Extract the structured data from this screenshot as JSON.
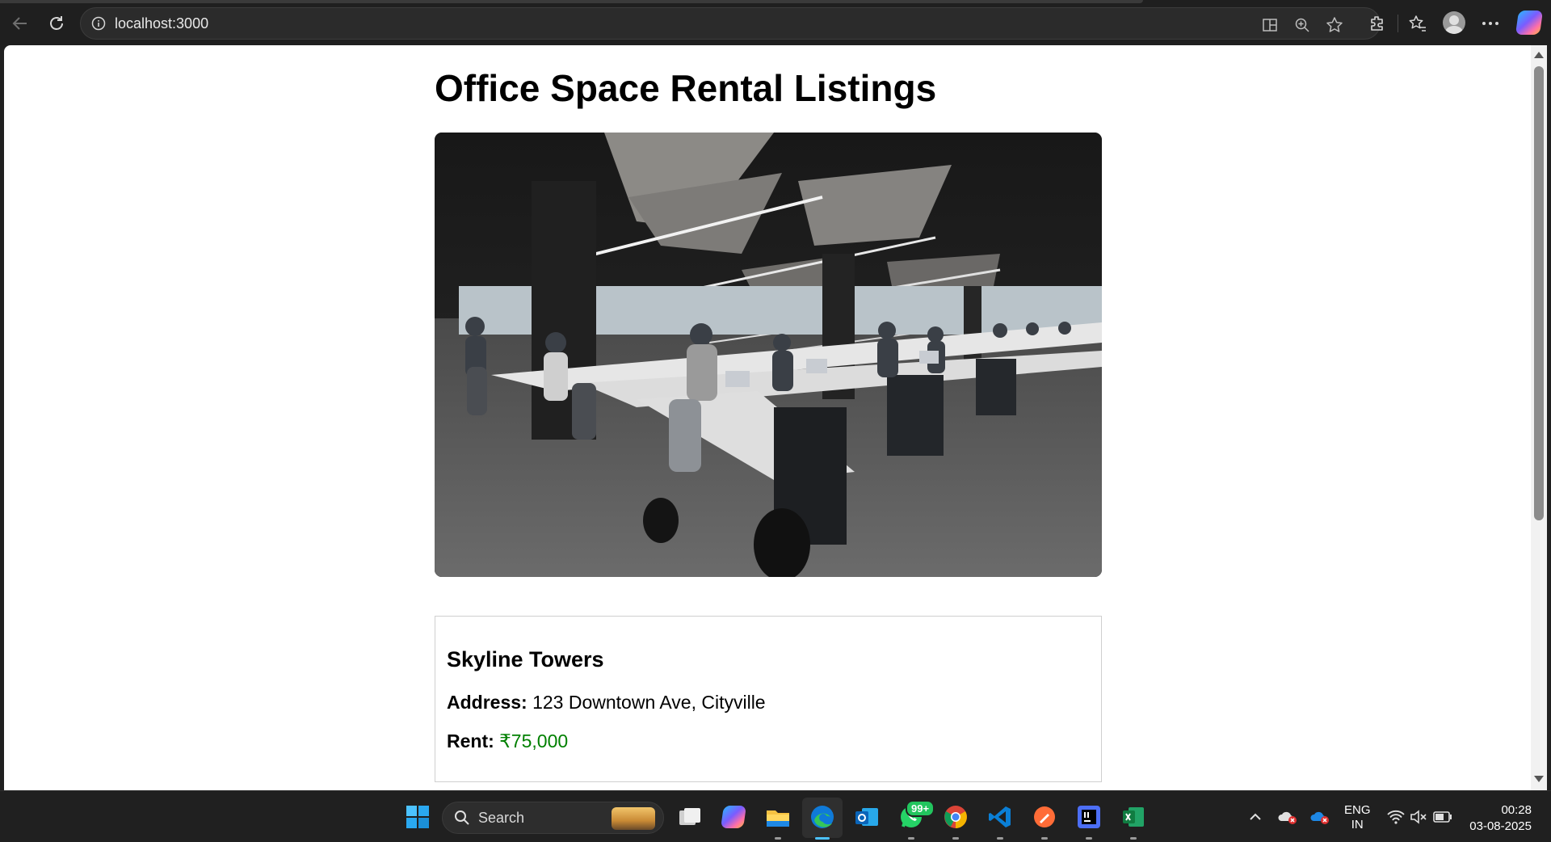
{
  "browser": {
    "url": "localhost:3000",
    "icons": [
      "back-arrow-icon",
      "refresh-icon",
      "site-info-icon",
      "split-screen-icon",
      "zoom-icon",
      "favorite-star-icon",
      "extensions-icon",
      "favorites-icon",
      "profile-avatar-icon",
      "more-options-icon",
      "copilot-icon"
    ]
  },
  "page": {
    "title": "Office Space Rental Listings",
    "hero_image": "open-plan-office-with-people-at-desks",
    "listing": {
      "name": "Skyline Towers",
      "address_label": "Address:",
      "address_value": "123 Downtown Ave, Cityville",
      "rent_label": "Rent:",
      "rent_value": "₹75,000",
      "rent_color": "#008000"
    }
  },
  "taskbar": {
    "search_label": "Search",
    "whatsapp_badge": "99+",
    "apps": [
      "windows-start-icon",
      "search-icon",
      "task-view-icon",
      "copilot-app-icon",
      "file-explorer-icon",
      "edge-browser-icon",
      "outlook-icon",
      "whatsapp-icon",
      "chrome-icon",
      "vscode-icon",
      "postman-icon",
      "intellij-icon",
      "excel-icon"
    ],
    "tray": {
      "language_line1": "ENG",
      "language_line2": "IN",
      "time": "00:28",
      "date": "03-08-2025"
    }
  }
}
